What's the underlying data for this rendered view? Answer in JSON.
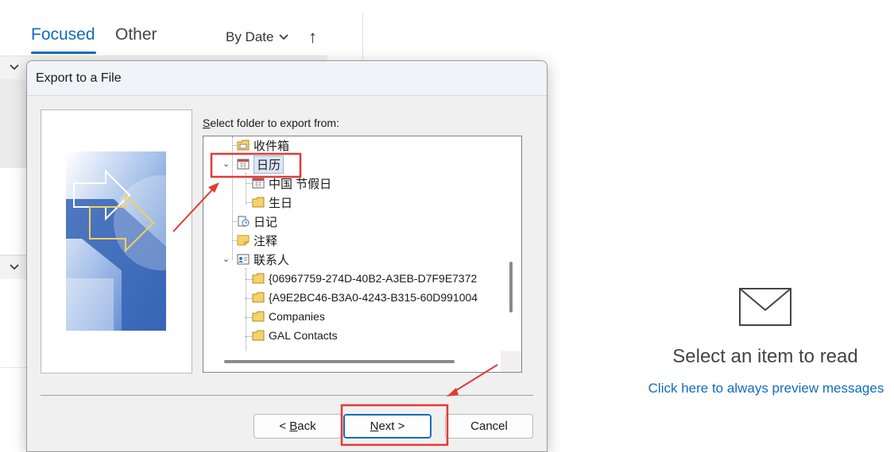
{
  "mail_list": {
    "tab_focused": "Focused",
    "tab_other": "Other",
    "sort_label": "By Date"
  },
  "reading_pane": {
    "title": "Select an item to read",
    "preview_link": "Click here to always preview messages"
  },
  "dialog": {
    "title": "Export to a File",
    "folder_label_accesskey": "S",
    "folder_label_rest": "elect folder to export from:",
    "tree": [
      {
        "label": "收件箱",
        "icon": "inbox-folder-icon"
      },
      {
        "label": "日历",
        "icon": "calendar-icon",
        "selected": true
      },
      {
        "label": "中国 节假日",
        "icon": "calendar-icon"
      },
      {
        "label": "生日",
        "icon": "folder-icon"
      },
      {
        "label": "日记",
        "icon": "journal-icon"
      },
      {
        "label": "注释",
        "icon": "note-icon"
      },
      {
        "label": "联系人",
        "icon": "contacts-icon"
      },
      {
        "label": "{06967759-274D-40B2-A3EB-D7F9E7372",
        "icon": "folder-icon"
      },
      {
        "label": "{A9E2BC46-B3A0-4243-B315-60D991004",
        "icon": "folder-icon"
      },
      {
        "label": "Companies",
        "icon": "folder-icon"
      },
      {
        "label": "GAL Contacts",
        "icon": "folder-icon"
      }
    ],
    "buttons": {
      "back_prefix": "< ",
      "back_key": "B",
      "back_rest": "ack",
      "next_key": "N",
      "next_rest": "ext >",
      "cancel": "Cancel"
    }
  },
  "colors": {
    "accent": "#0f6cbd",
    "annotation": "#e53935"
  }
}
